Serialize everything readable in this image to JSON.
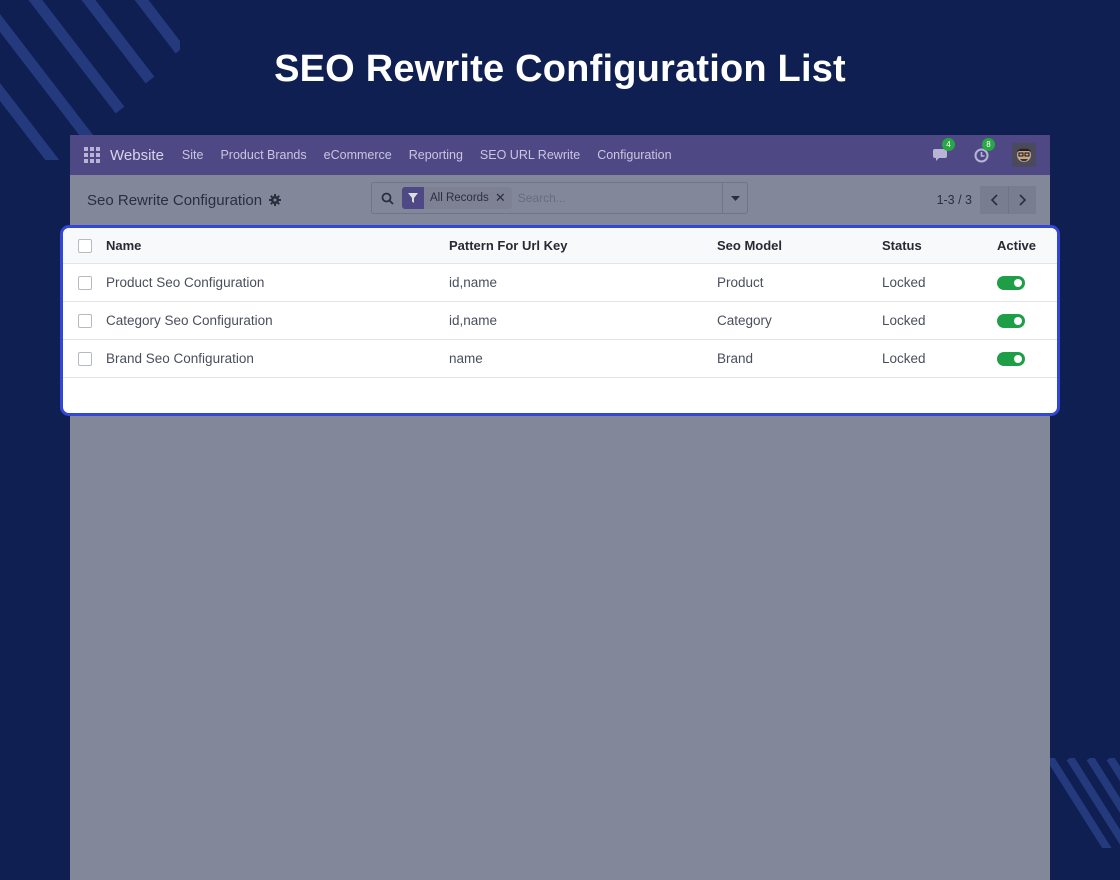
{
  "page": {
    "title": "SEO Rewrite Configuration List"
  },
  "navbar": {
    "app_name": "Website",
    "menu": [
      "Site",
      "Product Brands",
      "eCommerce",
      "Reporting",
      "SEO URL Rewrite",
      "Configuration"
    ],
    "messages_count": "4",
    "activities_count": "8"
  },
  "control_panel": {
    "breadcrumb": "Seo Rewrite Configuration",
    "search": {
      "facet": "All Records",
      "placeholder": "Search..."
    },
    "pager": "1-3 / 3"
  },
  "list": {
    "columns": [
      "Name",
      "Pattern For Url Key",
      "Seo Model",
      "Status",
      "Active"
    ],
    "rows": [
      {
        "name": "Product Seo Configuration",
        "pattern": "id,name",
        "model": "Product",
        "status": "Locked",
        "active": true
      },
      {
        "name": "Category Seo Configuration",
        "pattern": "id,name",
        "model": "Category",
        "status": "Locked",
        "active": true
      },
      {
        "name": "Brand Seo Configuration",
        "pattern": "name",
        "model": "Brand",
        "status": "Locked",
        "active": true
      }
    ]
  },
  "colors": {
    "background": "#0f1f52",
    "navbar": "#4e4985",
    "highlight_border": "#3246d8",
    "toggle_on": "#1f9e48"
  },
  "icons": [
    "apps-grid-icon",
    "chat-icon",
    "clock-icon",
    "gear-icon",
    "search-icon",
    "filter-icon",
    "close-icon",
    "caret-down-icon",
    "chevron-left-icon",
    "chevron-right-icon"
  ]
}
